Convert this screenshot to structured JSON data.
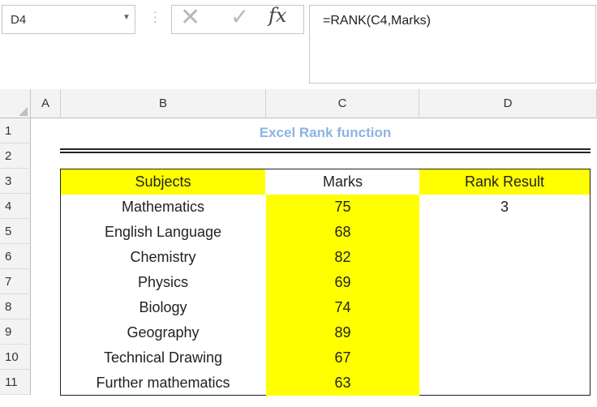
{
  "name_box": {
    "value": "D4"
  },
  "formula_bar": {
    "fx_label": "fx",
    "cancel_glyph": "✕",
    "enter_glyph": "✓",
    "formula": "=RANK(C4,Marks)"
  },
  "columns": [
    "A",
    "B",
    "C",
    "D"
  ],
  "rows": [
    "1",
    "2",
    "3",
    "4",
    "5",
    "6",
    "7",
    "8",
    "9",
    "10",
    "11"
  ],
  "sheet": {
    "title": "Excel Rank function",
    "headers": {
      "subjects": "Subjects",
      "marks": "Marks",
      "rank": "Rank Result"
    },
    "data": [
      {
        "subject": "Mathematics",
        "marks": "75",
        "rank": "3"
      },
      {
        "subject": "English Language",
        "marks": "68",
        "rank": ""
      },
      {
        "subject": "Chemistry",
        "marks": "82",
        "rank": ""
      },
      {
        "subject": "Physics",
        "marks": "69",
        "rank": ""
      },
      {
        "subject": "Biology",
        "marks": "74",
        "rank": ""
      },
      {
        "subject": "Geography",
        "marks": "89",
        "rank": ""
      },
      {
        "subject": "Technical Drawing",
        "marks": "67",
        "rank": ""
      },
      {
        "subject": "Further mathematics",
        "marks": "63",
        "rank": ""
      }
    ]
  },
  "colors": {
    "highlight": "#ffff00",
    "title": "#8db3e2"
  }
}
